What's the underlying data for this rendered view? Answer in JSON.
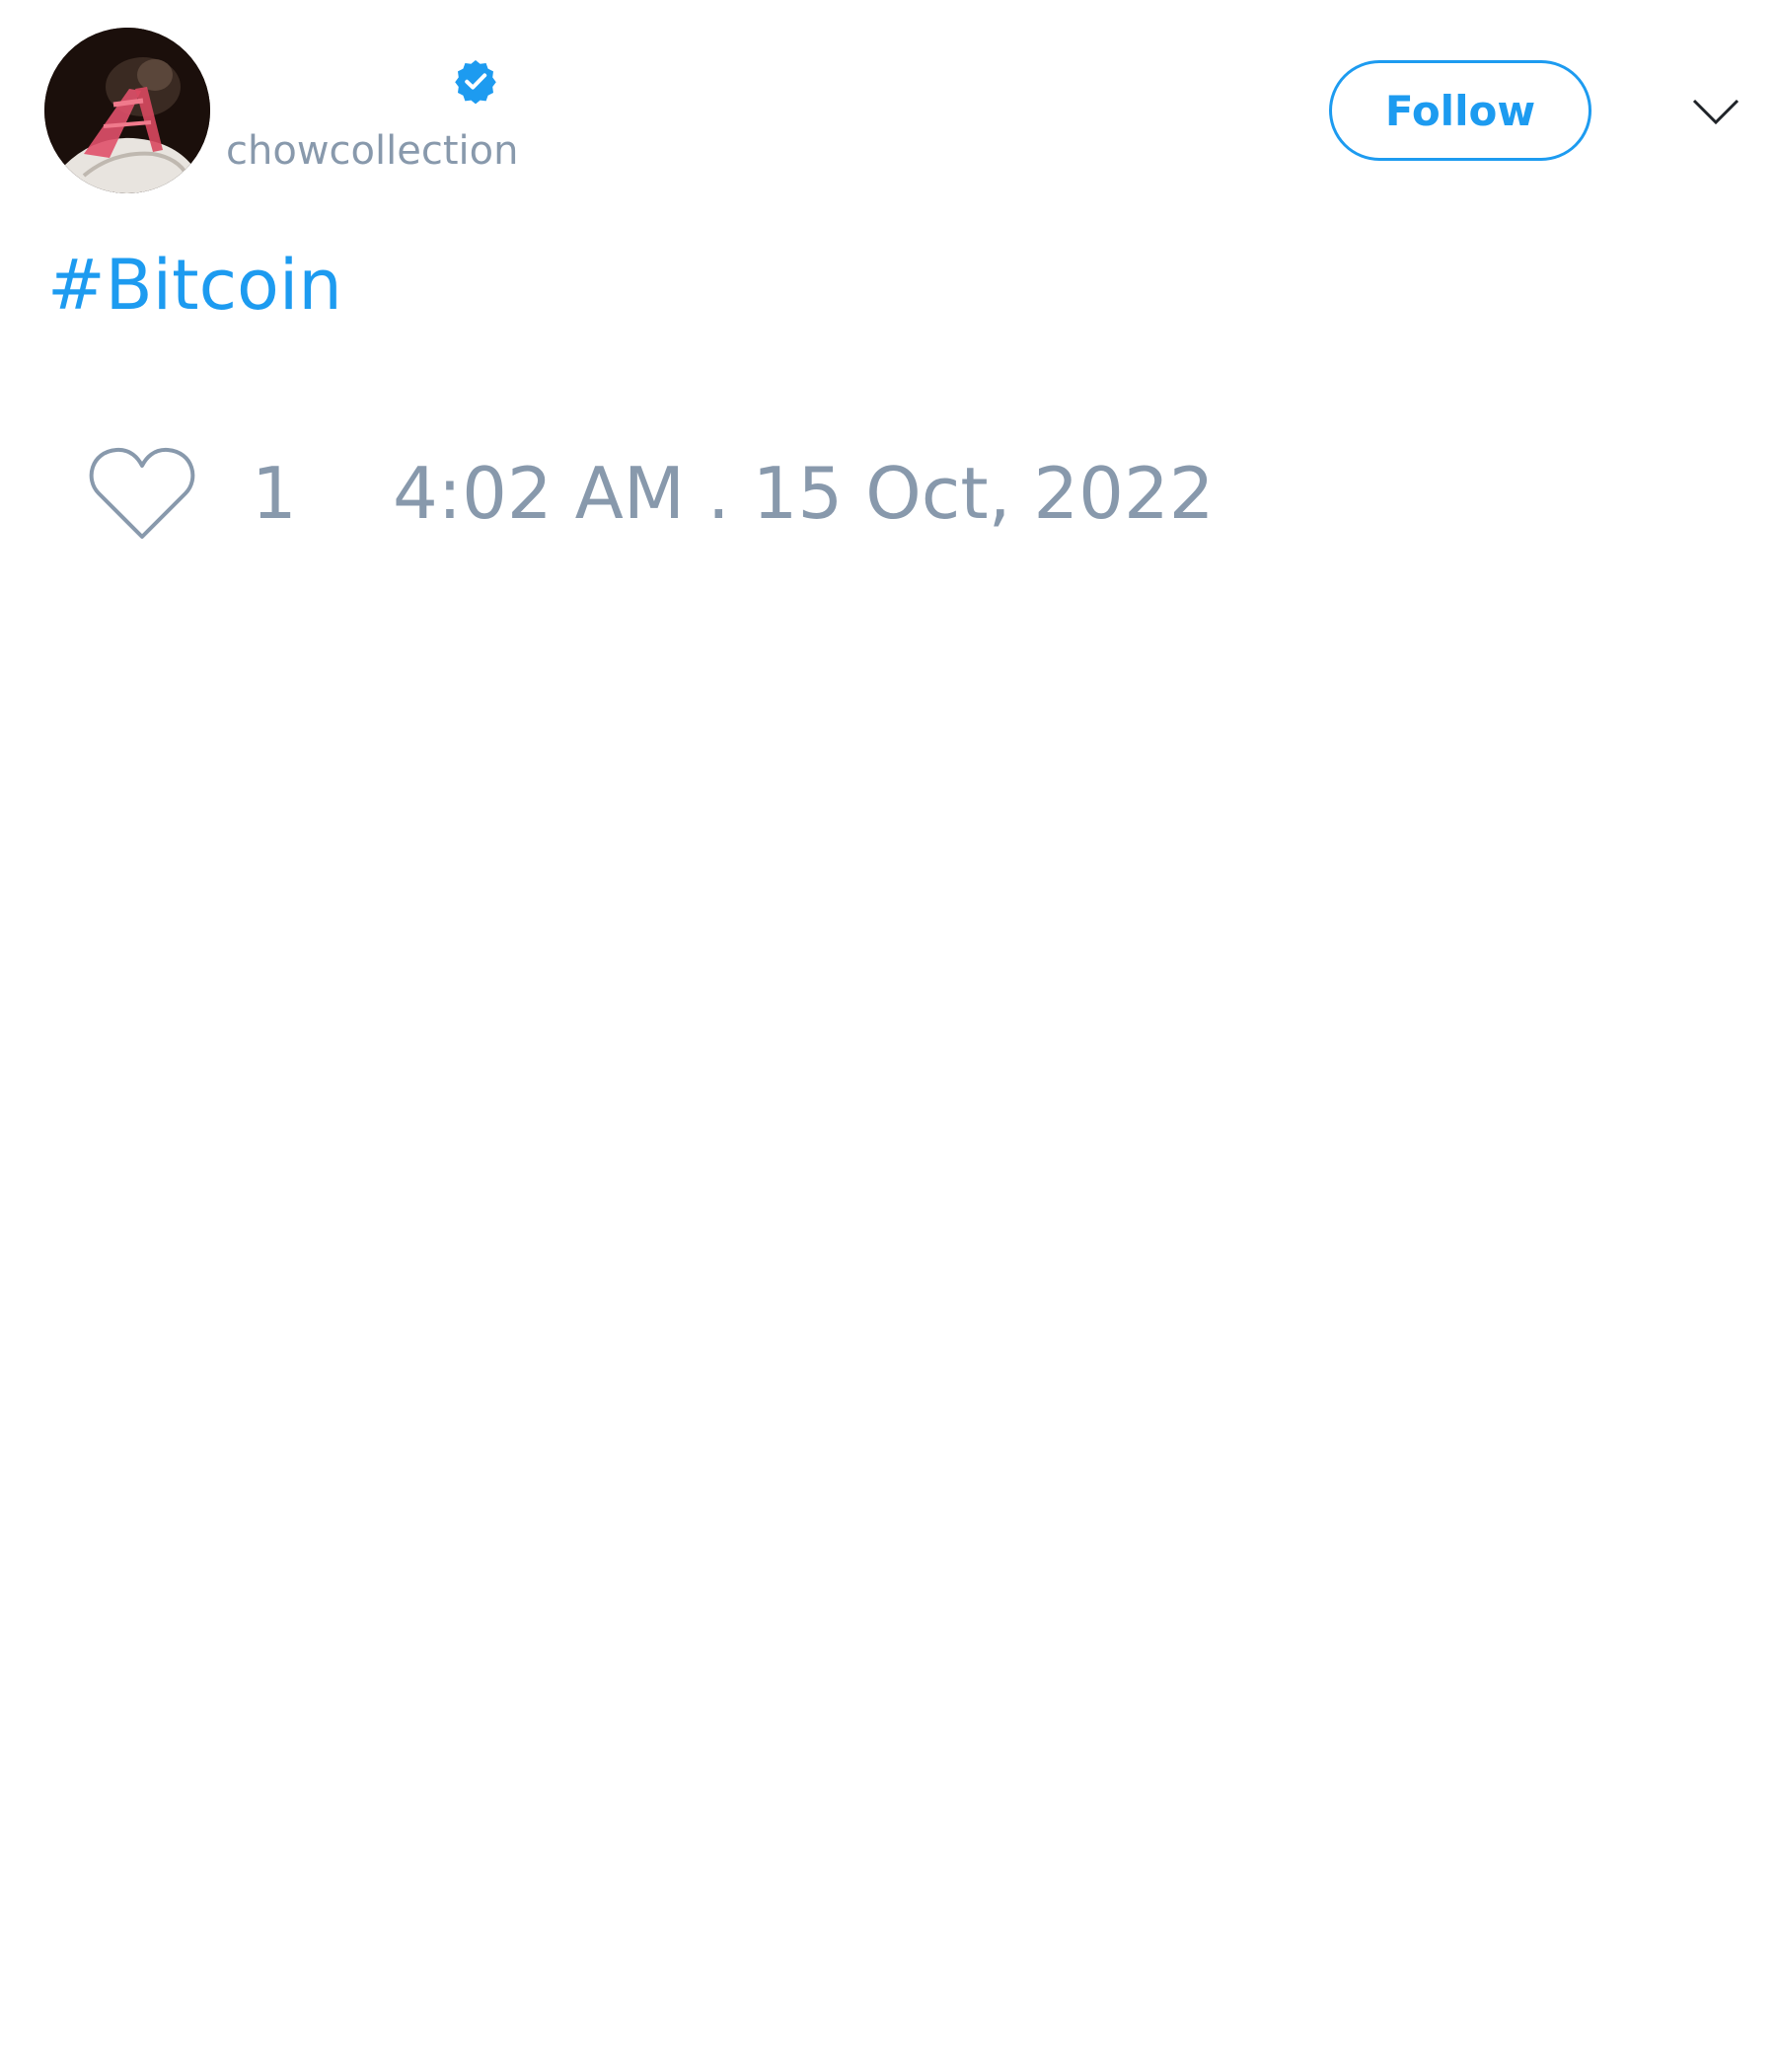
{
  "tweet": {
    "author": {
      "display_name": "",
      "handle": "chowcollection",
      "verified": true,
      "avatar_icon": "avatar-image"
    },
    "follow_label": "Follow",
    "menu_icon": "chevron-down-icon",
    "text": "#Bitcoin",
    "likes": "1",
    "timestamp": "4:02 AM . 15 Oct, 2022"
  },
  "colors": {
    "accent": "#1d9bf0",
    "muted": "#8899ac",
    "background": "#ffffff"
  }
}
